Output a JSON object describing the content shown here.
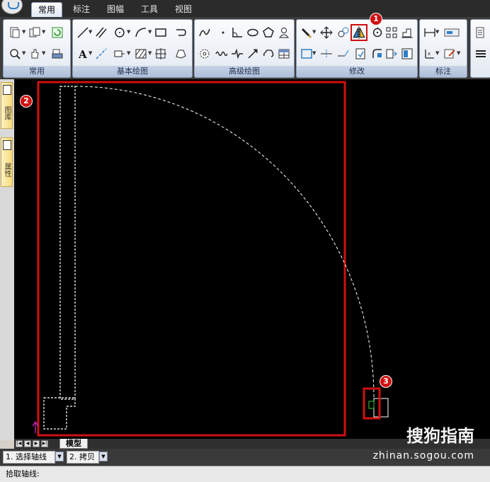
{
  "tabs": [
    "常用",
    "标注",
    "图幅",
    "工具",
    "视图"
  ],
  "active_tab": "常用",
  "ribbon_groups": [
    {
      "label": "常用"
    },
    {
      "label": "基本绘图"
    },
    {
      "label": "高级绘图"
    },
    {
      "label": "修改"
    },
    {
      "label": "标注"
    }
  ],
  "side_panel": {
    "tab1": "图库",
    "tab2": "属性"
  },
  "markers": [
    "1",
    "2",
    "3"
  ],
  "model_tab": "模型",
  "command_bar": {
    "step1_num": "1.",
    "step1_label": "选择轴线",
    "step2_num": "2.",
    "step2_label": "拷贝"
  },
  "status_prompt": "拾取轴线:",
  "watermark": {
    "brand": "搜狗指南",
    "url": "zhinan.sogou.com"
  },
  "colors": {
    "canvas": "#000000",
    "highlight": "#d01010",
    "accent": "#2f7fc8"
  }
}
